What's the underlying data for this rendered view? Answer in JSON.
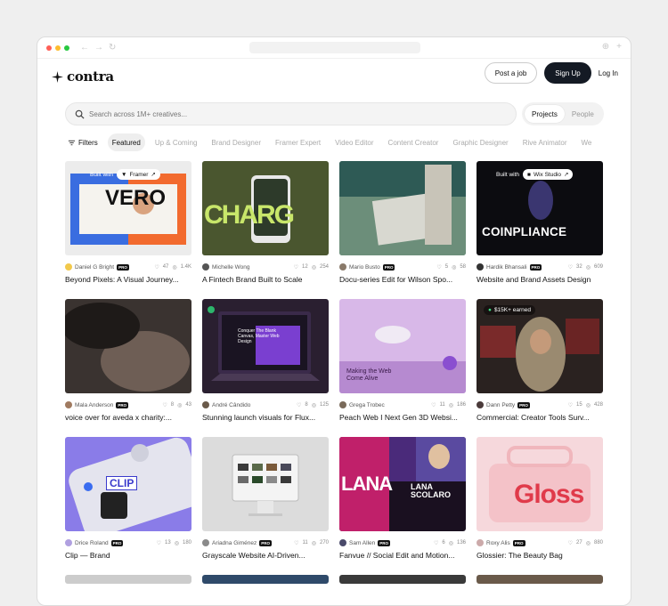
{
  "brand": {
    "name": "contra"
  },
  "header": {
    "post_job": "Post a job",
    "sign_up": "Sign Up",
    "login": "Log In"
  },
  "search": {
    "placeholder": "Search across 1M+ creatives..."
  },
  "toggle": {
    "projects": "Projects",
    "people": "People"
  },
  "filters": {
    "label": "Filters",
    "items": [
      "Featured",
      "Up & Coming",
      "Brand Designer",
      "Framer Expert",
      "Video Editor",
      "Content Creator",
      "Graphic Designer",
      "Rive Animator",
      "We"
    ]
  },
  "cards": [
    {
      "creator": "Daniel G Bright",
      "likes": "47",
      "views": "1.4K",
      "title": "Beyond Pixels: A Visual Journey...",
      "badge": "Framer",
      "badge_prefix": "Built with",
      "thumb_text": "VERO"
    },
    {
      "creator": "Michelle Wong",
      "likes": "12",
      "views": "254",
      "title": "A Fintech Brand Built to Scale",
      "thumb_text": "CHARG"
    },
    {
      "creator": "Mario Busto",
      "likes": "5",
      "views": "58",
      "title": "Docu-series Edit for Wilson Spo..."
    },
    {
      "creator": "Hardik Bhansali",
      "likes": "32",
      "views": "609",
      "title": "Website and Brand Assets Design",
      "badge": "Wix Studio",
      "badge_prefix": "Built with",
      "thumb_text": "COINPLIANCE"
    },
    {
      "creator": "Mala Anderson",
      "likes": "8",
      "views": "43",
      "title": "voice over for aveda x charity:..."
    },
    {
      "creator": "André Cândido",
      "likes": "8",
      "views": "125",
      "title": "Stunning launch visuals for Flux...",
      "thumb_text": "Conquer The Blank Canvas, Master Web Design"
    },
    {
      "creator": "Grega Trobec",
      "likes": "11",
      "views": "186",
      "title": "Peach Web I Next Gen 3D Websi...",
      "thumb_text": "Making the Web Come Alive"
    },
    {
      "creator": "Dann Petty",
      "likes": "15",
      "views": "428",
      "title": "Commercial: Creator Tools Surv...",
      "badge": "$15K+ earned"
    },
    {
      "creator": "Drice Roland",
      "likes": "13",
      "views": "180",
      "title": "Clip — Brand",
      "thumb_text": "CLIP"
    },
    {
      "creator": "Ariadna Giménez",
      "likes": "11",
      "views": "270",
      "title": "Grayscale Website AI-Driven..."
    },
    {
      "creator": "Sam Allen",
      "likes": "6",
      "views": "136",
      "title": "Fanvue // Social Edit and Motion...",
      "thumb_text": "LANA SCOLARO"
    },
    {
      "creator": "Roxy Alis",
      "likes": "27",
      "views": "880",
      "title": "Glossier: The Beauty Bag",
      "thumb_text": "Gloss"
    }
  ],
  "pro_label": "PRO"
}
